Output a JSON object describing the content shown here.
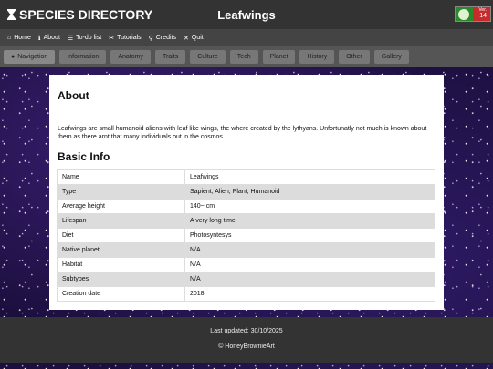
{
  "header": {
    "brand": "SPECIES DIRECTORY",
    "page_name": "Leafwings",
    "version_label": "Ver.",
    "version_number": "14"
  },
  "menu": [
    {
      "icon": "home-icon",
      "glyph": "⌂",
      "label": "Home"
    },
    {
      "icon": "info-icon",
      "glyph": "ℹ",
      "label": "About"
    },
    {
      "icon": "list-icon",
      "glyph": "☰",
      "label": "To-do list"
    },
    {
      "icon": "tools-icon",
      "glyph": "✂",
      "label": "Tutorials"
    },
    {
      "icon": "search-icon",
      "glyph": "⚲",
      "label": "Credits"
    },
    {
      "icon": "quit-icon",
      "glyph": "✕",
      "label": "Quit"
    }
  ],
  "subnav": [
    {
      "label": "Navigation",
      "icon": "compass-icon",
      "glyph": "●"
    },
    {
      "label": "Information"
    },
    {
      "label": "Anatomy"
    },
    {
      "label": "Traits"
    },
    {
      "label": "Culture"
    },
    {
      "label": "Tech"
    },
    {
      "label": "Planet"
    },
    {
      "label": "History"
    },
    {
      "label": "Other"
    },
    {
      "label": "Gallery"
    }
  ],
  "content": {
    "about_heading": "About",
    "description": "Leafwings are small humanoid aliens with leaf like wings, the where created by the lythyans. Unfortunatly not much is known about them as there arnt that many individuals out in the cosmos...",
    "basic_info_heading": "Basic Info",
    "rows": [
      {
        "label": "Name",
        "value": "Leafwings"
      },
      {
        "label": "Type",
        "value": "Sapient, Alien, Plant, Humanoid"
      },
      {
        "label": "Average height",
        "value": "140~ cm"
      },
      {
        "label": "Lifespan",
        "value": "A very long time"
      },
      {
        "label": "Diet",
        "value": "Photosyntesys"
      },
      {
        "label": "Native planet",
        "value": "N/A"
      },
      {
        "label": "Habitat",
        "value": "N/A"
      },
      {
        "label": "Subtypes",
        "value": "N/A"
      },
      {
        "label": "Creation date",
        "value": "2018"
      }
    ]
  },
  "footer": {
    "updated": "Last updated: 30/10/2025",
    "copyright": "© HoneyBrownieArt"
  },
  "colors": {
    "header_bg": "#333333",
    "menubar_bg": "#444444",
    "subnav_bg": "#555555",
    "row_alt_bg": "#dcdcdc",
    "space_bg": "#1c0f3e"
  }
}
